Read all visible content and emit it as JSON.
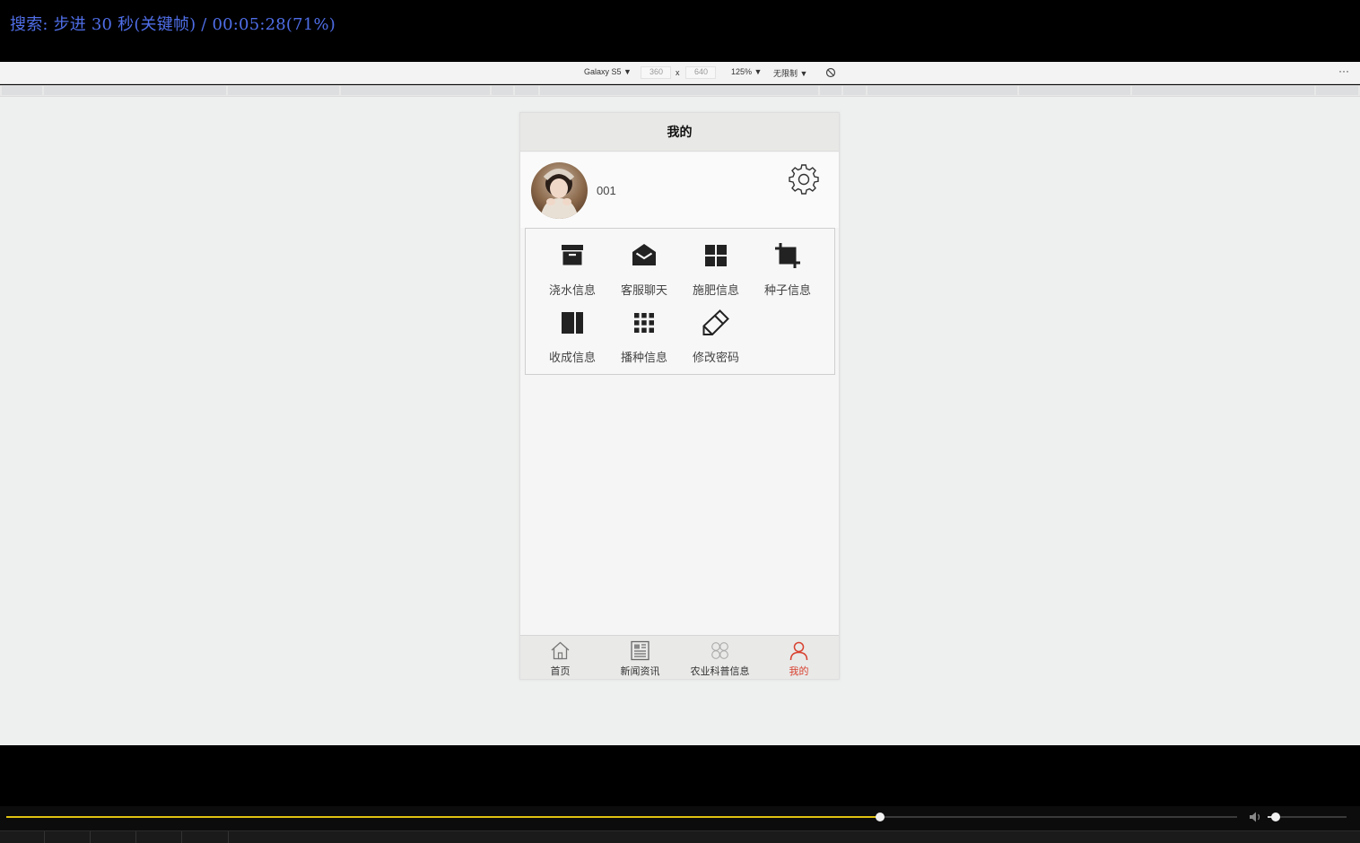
{
  "osd": {
    "text": "搜索: 步进 30 秒(关键帧) / 00:05:28(71%)"
  },
  "devtools": {
    "device": "Galaxy S5 ▼",
    "width": "360",
    "times": "x",
    "height": "640",
    "zoom": "125% ▼",
    "throttle": "无限制 ▼",
    "more": "⋮"
  },
  "app": {
    "title": "我的",
    "username": "001",
    "menu": [
      {
        "label": "浇水信息",
        "icon": "archive-icon"
      },
      {
        "label": "客服聊天",
        "icon": "envelope-open-icon"
      },
      {
        "label": "施肥信息",
        "icon": "grid-icon"
      },
      {
        "label": "种子信息",
        "icon": "crop-icon"
      },
      {
        "label": "收成信息",
        "icon": "columns-icon"
      },
      {
        "label": "播种信息",
        "icon": "apps-icon"
      },
      {
        "label": "修改密码",
        "icon": "pencil-icon"
      }
    ],
    "tabs": [
      {
        "label": "首页",
        "icon": "home-icon"
      },
      {
        "label": "新闻资讯",
        "icon": "newspaper-icon"
      },
      {
        "label": "农业科普信息",
        "icon": "four-circles-icon"
      },
      {
        "label": "我的",
        "icon": "user-icon",
        "active": true
      }
    ],
    "colors": {
      "active_tab": "#d8412f",
      "header_bg": "#e8e8e6"
    }
  },
  "player": {
    "progress_percent": 71,
    "volume_fraction": 0.1,
    "colors": {
      "progress": "#e0c210",
      "osd_text": "#4f6ee8"
    }
  }
}
